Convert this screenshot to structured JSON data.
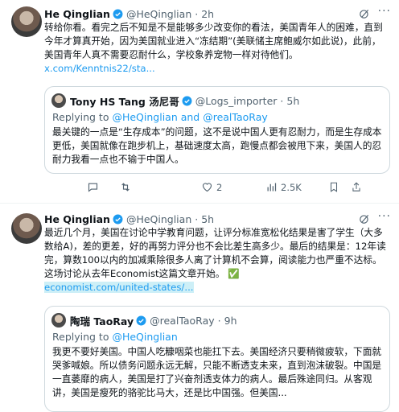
{
  "tweet1": {
    "author_name": "He Qinglian",
    "author_handle": "@HeQinglian",
    "time": "2h",
    "text": "转给你看。看完之后不知是不是能够多少改变你的看法，美国青年人的困难，直到今年才算真开始，因为美国就业进入“冻结期”(美联储主席鲍威尔如此说)，此前，美国青年人真不需要忍耐什么，学校象养宠物一样对待他们。",
    "link": "x.com/Kenntnis22/sta...",
    "quote": {
      "author_name": "Tony HS Tang 汤尼哥",
      "author_handle": "@Logs_importer",
      "time": "5h",
      "reply_prefix": "Replying to",
      "reply_to": "@HeQinglian and @realTaoRay",
      "text": "最关键的一点是“生存成本”的问题，这不是说中国人更有忍耐力，而是生存成本更低，美国就像在跑步机上，基础速度太高，跑慢点都会被甩下来，美国人的忍耐力我看一点也不输于中国人。"
    },
    "actions": {
      "likes": "2",
      "views": "2.5K"
    }
  },
  "tweet2": {
    "author_name": "He Qinglian",
    "author_handle": "@HeQinglian",
    "time": "5h",
    "text": "最近几个月，美国在讨论中学教育问题，让评分标准宽松化结果是害了学生（大多数给A)，差的更差，好的再努力评分也不会比差生高多少。最后的结果是：12年读完，算数100以内的加减乘除很多人离了计算机不会算，阅读能力也严重不达标。这场讨论从去年Economist这篇文章开始。",
    "check": "✅",
    "link": "economist.com/united-states/...",
    "quote": {
      "author_name": "陶瑞 TaoRay",
      "author_handle": "@realTaoRay",
      "time": "9h",
      "reply_prefix": "Replying to",
      "reply_to": "@HeQinglian",
      "text": "我更不要好美国。中国人吃糠咽菜也能扛下去。美国经济只要稍微疲软，下面就哭爹喊娘。所以债务问题永远无解，只能不断透支未来，直到泡沫破裂。中国是一直萎靡的病人，美国是打了兴奋剂透支体力的病人。最后殊途同归。从客观讲，美国是瘦死的骆驼比马大，还是比中国强。但美国..."
    }
  }
}
